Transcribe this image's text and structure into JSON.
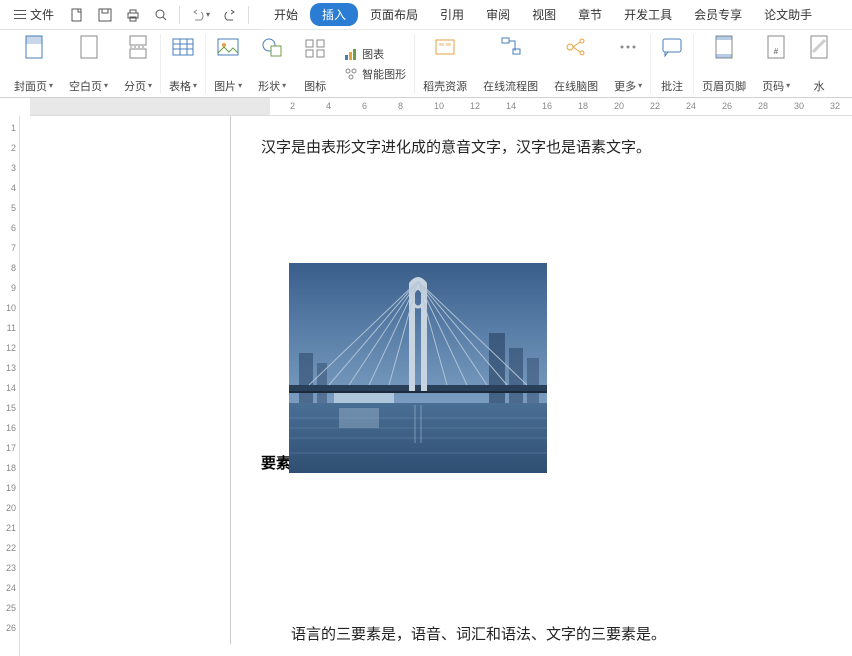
{
  "titlebar": {
    "file_label": "文件"
  },
  "menu": {
    "start": "开始",
    "insert": "插入",
    "layout": "页面布局",
    "reference": "引用",
    "review": "审阅",
    "view": "视图",
    "chapter": "章节",
    "dev": "开发工具",
    "member": "会员专享",
    "thesis": "论文助手"
  },
  "ribbon": {
    "cover": "封面页",
    "blank": "空白页",
    "pagebreak": "分页",
    "table": "表格",
    "picture": "图片",
    "shape": "形状",
    "icon": "图标",
    "chart": "图表",
    "smart": "智能图形",
    "resource": "稻壳资源",
    "flow": "在线流程图",
    "mind": "在线脑图",
    "more": "更多",
    "comment": "批注",
    "headerfooter": "页眉页脚",
    "pagenum": "页码",
    "watermark": "水"
  },
  "doc": {
    "line1": "汉字是由表形文字进化成的意音文字，汉字也是语素文字。",
    "img_caption": "要素",
    "line2": "语言的三要素是，语音、词汇和语法、文字的三要素是。"
  },
  "h_ticks": [
    "2",
    "4",
    "6",
    "8",
    "10",
    "12",
    "14",
    "16",
    "18",
    "20",
    "22",
    "24",
    "26",
    "28",
    "30",
    "32"
  ],
  "v_ticks": [
    "1",
    "2",
    "3",
    "4",
    "5",
    "6",
    "7",
    "8",
    "9",
    "10",
    "11",
    "12",
    "13",
    "14",
    "15",
    "16",
    "17",
    "18",
    "19",
    "20",
    "21",
    "22",
    "23",
    "24",
    "25",
    "26"
  ]
}
